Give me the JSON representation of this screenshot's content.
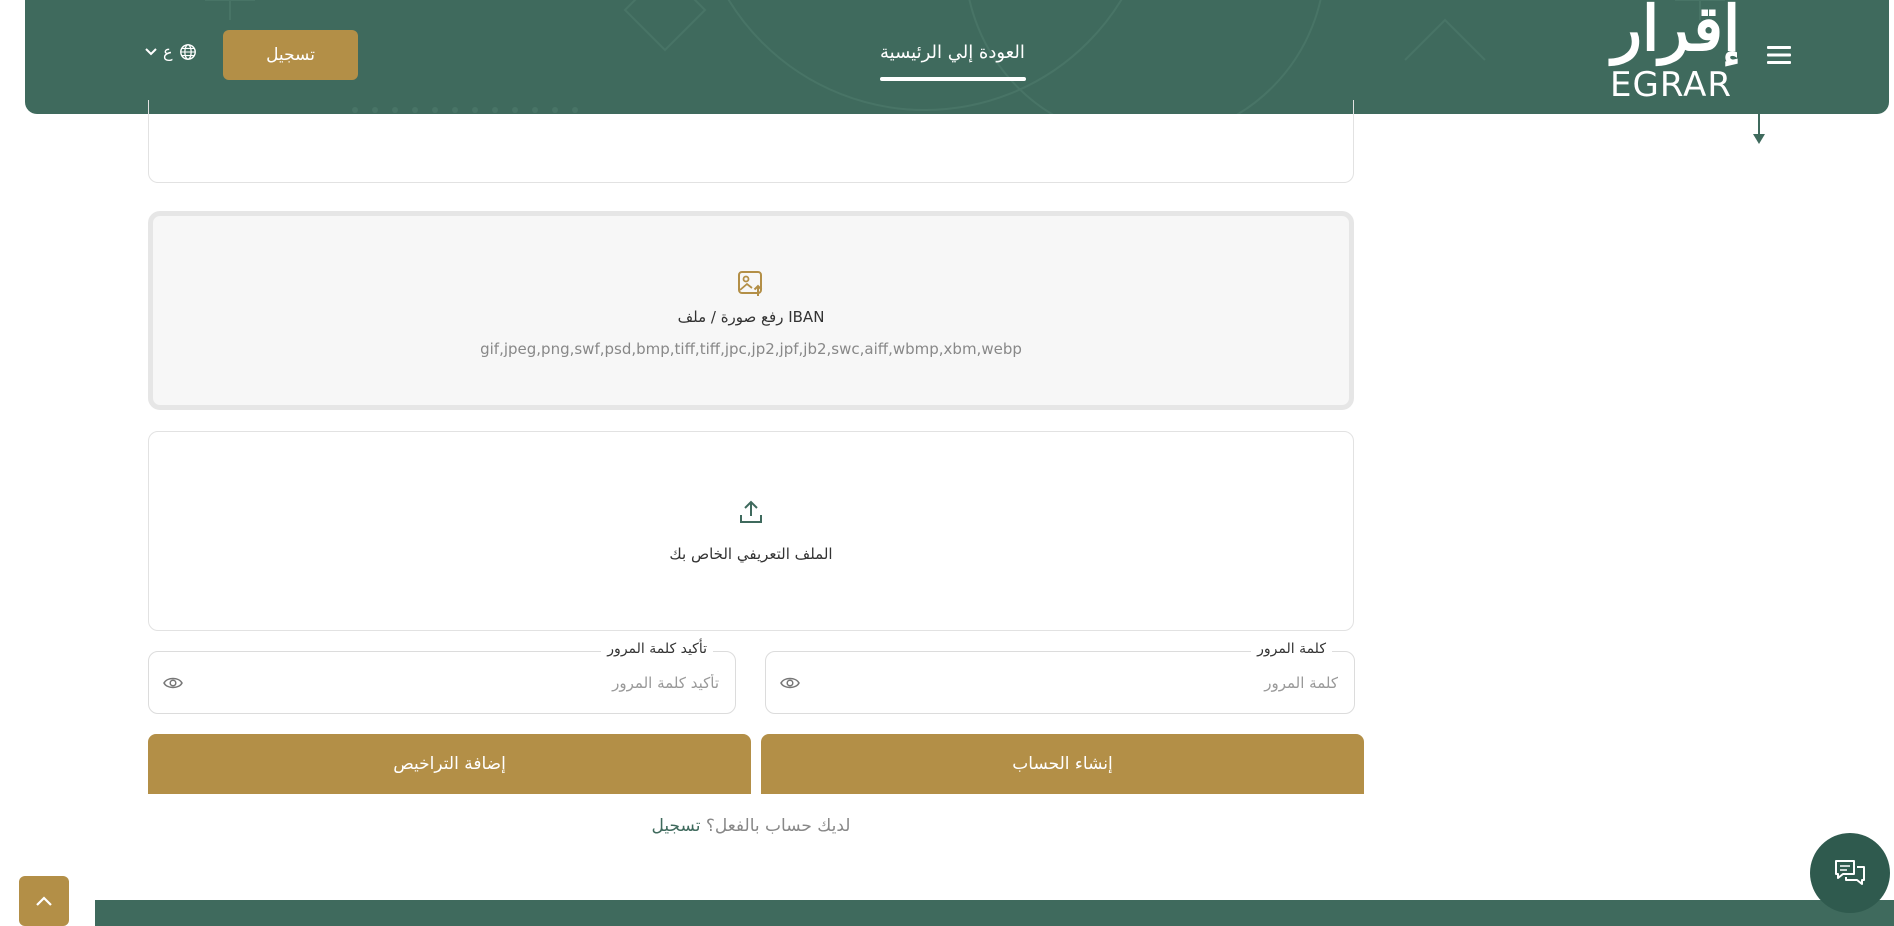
{
  "header": {
    "register_label": "تسجيل",
    "language_label": "ع",
    "home_link": "العودة إلي الرئيسية",
    "logo_ar": "إقرار",
    "logo_en": "EGRAR"
  },
  "iban_upload": {
    "title": "رفع صورة / ملف IBAN",
    "formats": "gif,jpeg,png,swf,psd,bmp,tiff,tiff,jpc,jp2,jpf,jb2,swc,aiff,wbmp,xbm,webp"
  },
  "profile_upload": {
    "title": "الملف التعريفي الخاص بك"
  },
  "password_field": {
    "label": "كلمة المرور",
    "placeholder": "كلمة المرور"
  },
  "confirm_field": {
    "label": "تأكيد كلمة المرور",
    "placeholder": "تأكيد كلمة المرور"
  },
  "buttons": {
    "create_account": "إنشاء الحساب",
    "add_licenses": "إضافة التراخيص"
  },
  "login_prompt": {
    "text": "لديك حساب بالفعل؟",
    "link": "تسجيل"
  },
  "colors": {
    "primary_green": "#3f6a5d",
    "accent_gold": "#b38f47"
  }
}
